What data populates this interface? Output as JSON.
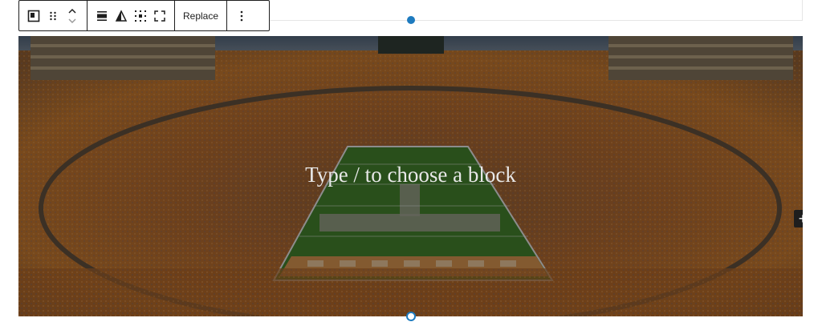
{
  "toolbar": {
    "replace_label": "Replace"
  },
  "cover": {
    "placeholder": "Type / to choose a block",
    "inserter_label": "+"
  },
  "colors": {
    "accent": "#1e7bbf",
    "toolbar_border": "#1e1e1e",
    "field_green": "#3f7a2a",
    "crowd_orange": "#c8762a"
  },
  "icons": [
    "block-type-icon",
    "drag-handle-icon",
    "move-up-icon",
    "move-down-icon",
    "align-icon",
    "contrast-icon",
    "focal-point-icon",
    "fullscreen-icon",
    "more-options-icon"
  ]
}
